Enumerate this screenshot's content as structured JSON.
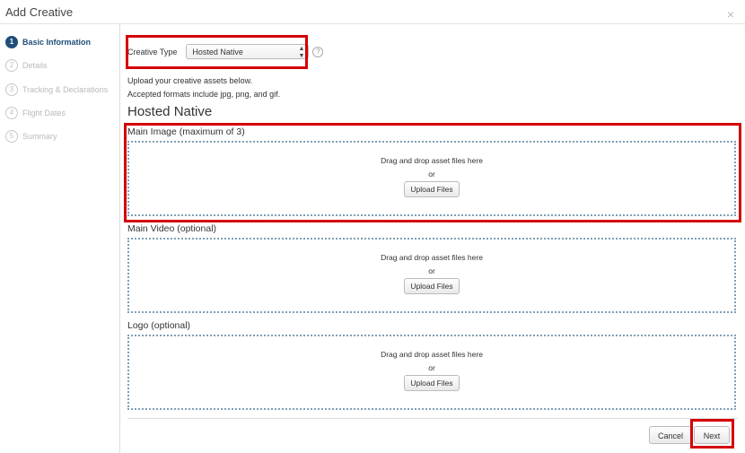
{
  "window": {
    "title": "Add Creative",
    "close_icon": "×"
  },
  "steps": [
    {
      "num": "1",
      "label": "Basic Information",
      "active": true
    },
    {
      "num": "2",
      "label": "Details",
      "active": false
    },
    {
      "num": "3",
      "label": "Tracking & Declarations",
      "active": false
    },
    {
      "num": "4",
      "label": "Flight Dates",
      "active": false
    },
    {
      "num": "5",
      "label": "Summary",
      "active": false
    }
  ],
  "form": {
    "creative_type_label": "Creative Type",
    "creative_type_value": "Hosted Native",
    "help_icon": "?",
    "intro_line1": "Upload your creative assets below.",
    "intro_line2": "Accepted formats include jpg, png, and gif.",
    "heading": "Hosted Native"
  },
  "sections": [
    {
      "label": "Main Image (maximum of 3)",
      "drop_text": "Drag and drop asset files here",
      "or_text": "or",
      "button": "Upload Files"
    },
    {
      "label": "Main Video (optional)",
      "drop_text": "Drag and drop asset files here",
      "or_text": "or",
      "button": "Upload Files"
    },
    {
      "label": "Logo (optional)",
      "drop_text": "Drag and drop asset files here",
      "or_text": "or",
      "button": "Upload Files"
    }
  ],
  "footer": {
    "cancel": "Cancel",
    "next": "Next"
  },
  "colors": {
    "accent": "#1f4e79",
    "highlight": "#d40000",
    "dropzone_border": "#7f9fb5"
  }
}
